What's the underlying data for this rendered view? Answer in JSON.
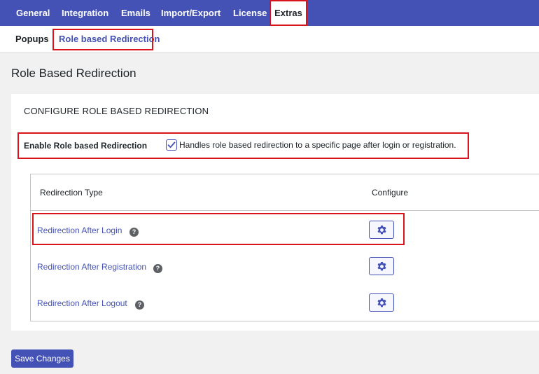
{
  "topnav": {
    "tabs": [
      {
        "label": "General"
      },
      {
        "label": "Integration"
      },
      {
        "label": "Emails"
      },
      {
        "label": "Import/Export"
      },
      {
        "label": "License"
      },
      {
        "label": "Extras",
        "active": true
      }
    ]
  },
  "subnav": {
    "tabs": [
      {
        "label": "Popups"
      },
      {
        "label": "Role based Redirection",
        "active": true
      }
    ]
  },
  "page": {
    "title": "Role Based Redirection"
  },
  "card": {
    "title": "CONFIGURE ROLE BASED REDIRECTION",
    "enable": {
      "label": "Enable Role based Redirection",
      "checked": true,
      "description": "Handles role based redirection to a specific page after login or registration."
    },
    "table": {
      "headers": [
        "Redirection Type",
        "Configure"
      ],
      "rows": [
        {
          "label": "Redirection After Login",
          "help": "?"
        },
        {
          "label": "Redirection After Registration",
          "help": "?"
        },
        {
          "label": "Redirection After Logout",
          "help": "?"
        }
      ]
    }
  },
  "actions": {
    "save_label": "Save Changes"
  },
  "colors": {
    "accent": "#4452b5",
    "highlight": "#d9141c"
  },
  "icons": {
    "configure": "gear-icon",
    "help": "help-icon",
    "checkbox": "checkmark-icon"
  }
}
